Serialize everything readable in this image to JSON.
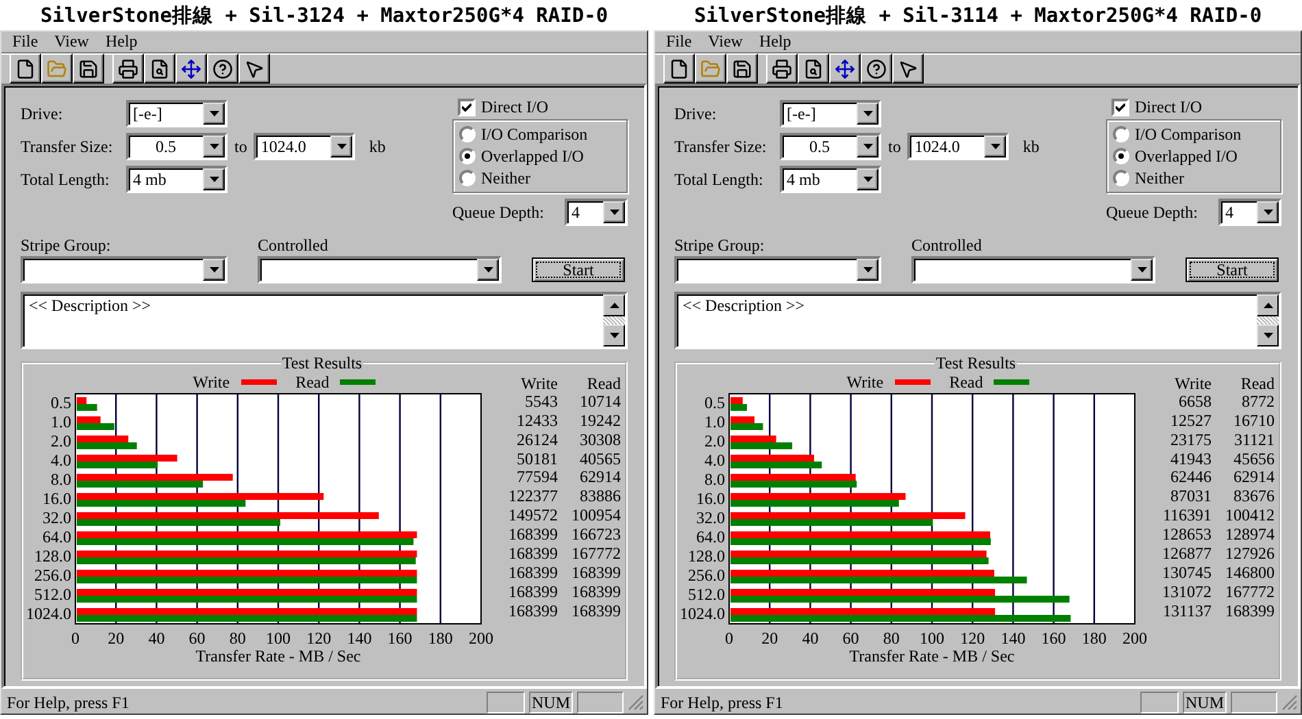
{
  "windows": [
    {
      "title": "SilverStone排線 + Sil-3124 + Maxtor250G*4 RAID-0",
      "menu": [
        "File",
        "View",
        "Help"
      ],
      "settings": {
        "drive": {
          "label": "Drive:",
          "value": "[-e-]"
        },
        "transfer_size": {
          "label": "Transfer Size:",
          "from": "0.5",
          "to_label": "to",
          "to": "1024.0",
          "unit": "kb"
        },
        "total_length": {
          "label": "Total Length:",
          "value": "4 mb"
        },
        "direct_io": {
          "label": "Direct I/O",
          "checked": true
        },
        "io_modes": [
          {
            "label": "I/O Comparison",
            "selected": false
          },
          {
            "label": "Overlapped I/O",
            "selected": true
          },
          {
            "label": "Neither",
            "selected": false
          }
        ],
        "queue_depth": {
          "label": "Queue Depth:",
          "value": "4"
        },
        "stripe_group": {
          "label": "Stripe Group:"
        },
        "controlled": {
          "label": "Controlled"
        },
        "start_button": "Start",
        "description": "<< Description >>"
      },
      "results": {
        "title": "Test Results",
        "columns": [
          "Write",
          "Read"
        ],
        "rows": [
          [
            "5543",
            "10714"
          ],
          [
            "12433",
            "19242"
          ],
          [
            "26124",
            "30308"
          ],
          [
            "50181",
            "40565"
          ],
          [
            "77594",
            "62914"
          ],
          [
            "122377",
            "83886"
          ],
          [
            "149572",
            "100954"
          ],
          [
            "168399",
            "166723"
          ],
          [
            "168399",
            "167772"
          ],
          [
            "168399",
            "168399"
          ],
          [
            "168399",
            "168399"
          ],
          [
            "168399",
            "168399"
          ]
        ],
        "chart_data": {
          "type": "bar",
          "orientation": "horizontal",
          "grid": true,
          "xlabel": "Transfer Rate - MB / Sec",
          "categories": [
            "0.5",
            "1.0",
            "2.0",
            "4.0",
            "8.0",
            "16.0",
            "32.0",
            "64.0",
            "128.0",
            "256.0",
            "512.0",
            "1024.0"
          ],
          "series": [
            {
              "name": "Write",
              "color": "#ff0000",
              "values": [
                5.5,
                12.4,
                26.1,
                50.2,
                77.6,
                122.4,
                149.6,
                168.4,
                168.4,
                168.4,
                168.4,
                168.4
              ]
            },
            {
              "name": "Read",
              "color": "#008000",
              "values": [
                10.7,
                19.2,
                30.3,
                40.6,
                62.9,
                83.9,
                101.0,
                166.7,
                167.8,
                168.4,
                168.4,
                168.4
              ]
            }
          ],
          "xlim": [
            0,
            200
          ],
          "xticks": [
            0,
            20,
            40,
            60,
            80,
            100,
            120,
            140,
            160,
            180,
            200
          ]
        }
      },
      "status_bar": {
        "text": "For Help, press F1",
        "indicator": "NUM"
      }
    },
    {
      "title": "SilverStone排線 + Sil-3114 + Maxtor250G*4 RAID-0",
      "menu": [
        "File",
        "View",
        "Help"
      ],
      "settings": {
        "drive": {
          "label": "Drive:",
          "value": "[-e-]"
        },
        "transfer_size": {
          "label": "Transfer Size:",
          "from": "0.5",
          "to_label": "to",
          "to": "1024.0",
          "unit": "kb"
        },
        "total_length": {
          "label": "Total Length:",
          "value": "4 mb"
        },
        "direct_io": {
          "label": "Direct I/O",
          "checked": true
        },
        "io_modes": [
          {
            "label": "I/O Comparison",
            "selected": false
          },
          {
            "label": "Overlapped I/O",
            "selected": true
          },
          {
            "label": "Neither",
            "selected": false
          }
        ],
        "queue_depth": {
          "label": "Queue Depth:",
          "value": "4"
        },
        "stripe_group": {
          "label": "Stripe Group:"
        },
        "controlled": {
          "label": "Controlled"
        },
        "start_button": "Start",
        "description": "<< Description >>"
      },
      "results": {
        "title": "Test Results",
        "columns": [
          "Write",
          "Read"
        ],
        "rows": [
          [
            "6658",
            "8772"
          ],
          [
            "12527",
            "16710"
          ],
          [
            "23175",
            "31121"
          ],
          [
            "41943",
            "45656"
          ],
          [
            "62446",
            "62914"
          ],
          [
            "87031",
            "83676"
          ],
          [
            "116391",
            "100412"
          ],
          [
            "128653",
            "128974"
          ],
          [
            "126877",
            "127926"
          ],
          [
            "130745",
            "146800"
          ],
          [
            "131072",
            "167772"
          ],
          [
            "131137",
            "168399"
          ]
        ],
        "chart_data": {
          "type": "bar",
          "orientation": "horizontal",
          "grid": true,
          "xlabel": "Transfer Rate - MB / Sec",
          "categories": [
            "0.5",
            "1.0",
            "2.0",
            "4.0",
            "8.0",
            "16.0",
            "32.0",
            "64.0",
            "128.0",
            "256.0",
            "512.0",
            "1024.0"
          ],
          "series": [
            {
              "name": "Write",
              "color": "#ff0000",
              "values": [
                6.7,
                12.5,
                23.2,
                41.9,
                62.4,
                87.0,
                116.4,
                128.7,
                126.9,
                130.7,
                131.1,
                131.1
              ]
            },
            {
              "name": "Read",
              "color": "#008000",
              "values": [
                8.8,
                16.7,
                31.1,
                45.7,
                62.9,
                83.7,
                100.4,
                129.0,
                127.9,
                146.8,
                167.8,
                168.4
              ]
            }
          ],
          "xlim": [
            0,
            200
          ],
          "xticks": [
            0,
            20,
            40,
            60,
            80,
            100,
            120,
            140,
            160,
            180,
            200
          ]
        }
      },
      "status_bar": {
        "text": "For Help, press F1",
        "indicator": "NUM"
      }
    }
  ]
}
